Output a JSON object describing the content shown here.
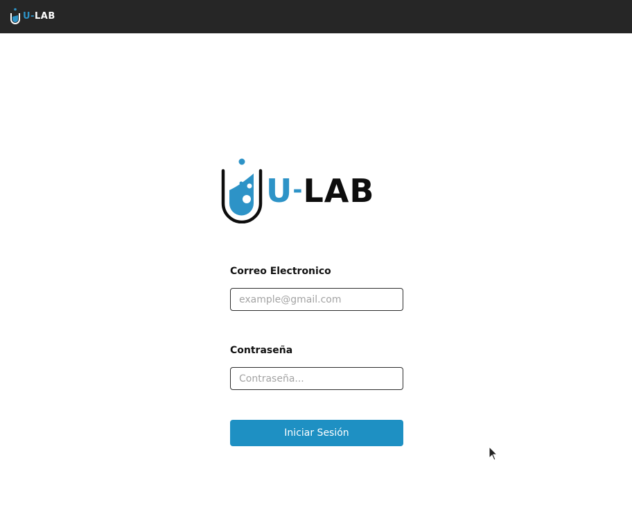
{
  "header": {
    "logo": {
      "prefix": "U",
      "dash": "-",
      "suffix": "LAB",
      "icon": "test-tube-icon"
    }
  },
  "main": {
    "logo": {
      "prefix": "U",
      "dash": "-",
      "suffix": "LAB",
      "icon": "test-tube-icon"
    }
  },
  "login_form": {
    "email_label": "Correo Electronico",
    "email_placeholder": "example@gmail.com",
    "email_value": "",
    "password_label": "Contraseña",
    "password_placeholder": "Contraseña...",
    "password_value": "",
    "submit_label": "Iniciar Sesión"
  },
  "colors": {
    "topbar": "#262626",
    "brand_blue": "#2d93c7",
    "button": "#1e90c3"
  }
}
